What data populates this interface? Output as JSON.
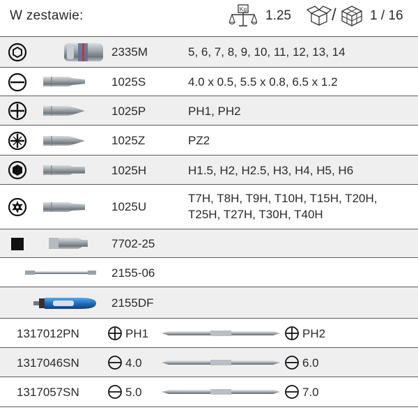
{
  "header": {
    "title": "W zestawie:",
    "weight_unit": "Kg",
    "weight": "1.25",
    "separator": "/",
    "pack": "1 / 16"
  },
  "rows": [
    {
      "code": "2335M",
      "sizes": "5, 6, 7, 8, 9, 10, 11, 12, 13, 14",
      "symbol": "hex-socket-icon",
      "tool": "socket-icon"
    },
    {
      "code": "1025S",
      "sizes": "4.0 x 0.5, 5.5 x 0.8, 6.5 x 1.2",
      "symbol": "slotted-icon",
      "tool": "bit-icon"
    },
    {
      "code": "1025P",
      "sizes": "PH1, PH2",
      "symbol": "phillips-icon",
      "tool": "bit-icon"
    },
    {
      "code": "1025Z",
      "sizes": "PZ2",
      "symbol": "pozidriv-icon",
      "tool": "bit-icon"
    },
    {
      "code": "1025H",
      "sizes": "H1.5, H2, H2.5, H3, H4, H5, H6",
      "symbol": "hex-key-icon",
      "tool": "bit-icon"
    },
    {
      "code": "1025U",
      "sizes_line1": "T7H, T8H, T9H, T10H, T15H, T20H,",
      "sizes_line2": "T25H, T27H, T30H, T40H",
      "symbol": "torx-icon",
      "tool": "bit-icon"
    },
    {
      "code": "7702-25",
      "symbol": "square-drive-icon",
      "tool": "adapter-icon"
    },
    {
      "code": "2155-06",
      "tool": "extension-bar-icon"
    },
    {
      "code": "2155DF",
      "tool": "screwdriver-handle-icon"
    }
  ],
  "screwdrivers": [
    {
      "code": "1317012PN",
      "left": "PH1",
      "right": "PH2",
      "symbol": "phillips-icon"
    },
    {
      "code": "1317046SN",
      "left": "4.0",
      "right": "6.0",
      "symbol": "slotted-icon"
    },
    {
      "code": "1317057SN",
      "left": "5.0",
      "right": "7.0",
      "symbol": "slotted-icon"
    }
  ],
  "colors": {
    "separator": "#5a5a5a",
    "row_bg": "#efefef",
    "text": "#2a2a2a",
    "handle_blue": "#1f6fc0"
  }
}
